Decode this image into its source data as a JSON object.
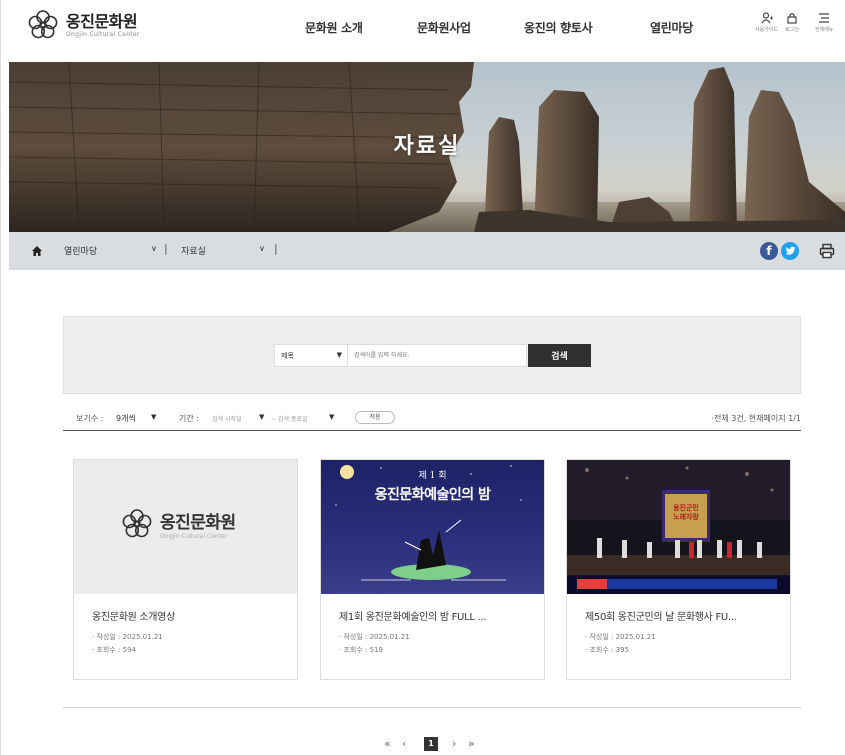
{
  "brand": {
    "name": "옹진문화원",
    "subtitle": "Ongjin Cultural Center"
  },
  "gnb": [
    {
      "label": "문화원 소개"
    },
    {
      "label": "문화원사업"
    },
    {
      "label": "옹진의 향토사"
    },
    {
      "label": "열린마당"
    }
  ],
  "util": [
    {
      "label": "사용가이드",
      "icon": "user-icon"
    },
    {
      "label": "로그인",
      "icon": "login-icon"
    },
    {
      "label": "전체메뉴",
      "icon": "menu-icon"
    }
  ],
  "hero": {
    "title": "자료실"
  },
  "breadcrumb": {
    "level1": "열린마당",
    "level2": "자료실",
    "share": {
      "facebook": "f",
      "facebook_color": "#3b5998",
      "twitter_color": "#1da1f2"
    }
  },
  "search": {
    "select_value": "제목",
    "placeholder": "검색어를 입력 하세요.",
    "button": "검색"
  },
  "filter": {
    "view_label": "보기수 :",
    "view_value": "9개씩",
    "period_label": "기간 :",
    "start_date": "검색 시작일",
    "end_date": "~ 검색 종료일",
    "apply": "적용",
    "total": "·전체 3건, 현재페이지 1/1"
  },
  "cards": [
    {
      "title": "옹진문화원 소개영상",
      "date": "· 작성일 : 2025.01.21",
      "views": "· 조회수 : 594",
      "thumb_logo": "옹진문화원",
      "thumb_sub": "Ongjin Cultural Center"
    },
    {
      "title": "제1회 옹진문화예술인의 밤 FULL ...",
      "date": "· 작성일 : 2025.01.21",
      "views": "· 조회수 : 519",
      "thumb_text1": "제 1 회",
      "thumb_text2": "옹진문화예술인의 밤"
    },
    {
      "title": "제50회 옹진군민의 날 문화행사 FU...",
      "date": "· 작성일 : 2025.01.21",
      "views": "· 조회수 : 395",
      "thumb_text1": "옹진군민",
      "thumb_text2": "노래자랑"
    }
  ],
  "pagination": {
    "first": "«",
    "prev": "‹",
    "current": "1",
    "next": "›",
    "last": "»"
  },
  "colors": {
    "accent": "#303030",
    "hero_text": "#ffffff"
  }
}
